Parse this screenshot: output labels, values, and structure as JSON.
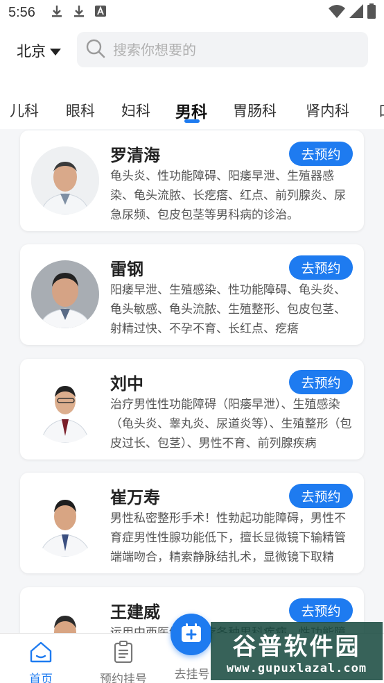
{
  "status_bar": {
    "time": "5:56"
  },
  "header": {
    "city": "北京",
    "search_placeholder": "搜索你想要的"
  },
  "tabs": [
    {
      "label": "儿科",
      "active": false
    },
    {
      "label": "眼科",
      "active": false
    },
    {
      "label": "妇科",
      "active": false
    },
    {
      "label": "男科",
      "active": true
    },
    {
      "label": "胃肠科",
      "active": false
    },
    {
      "label": "肾内科",
      "active": false
    },
    {
      "label": "口",
      "active": false
    }
  ],
  "doctors": [
    {
      "name": "罗清海",
      "book_label": "去预约",
      "description": "龟头炎、性功能障碍、阳痿早泄、生殖器感染、龟头流脓、长疙瘩、红点、前列腺炎、尿急尿频、包皮包茎等男科病的诊治。"
    },
    {
      "name": "雷钢",
      "book_label": "去预约",
      "description": "阳痿早泄、生殖感染、性功能障碍、龟头炎、龟头敏感、龟头流脓、生殖整形、包皮包茎、射精过快、不孕不育、长红点、疙瘩"
    },
    {
      "name": "刘中",
      "book_label": "去预约",
      "description": "治疗男性性功能障碍（阳痿早泄）、生殖感染（龟头炎、睾丸炎、尿道炎等）、生殖整形（包皮过长、包茎）、男性不育、前列腺疾病"
    },
    {
      "name": "崔万寿",
      "book_label": "去预约",
      "description": "男性私密整形手术！性勃起功能障碍，男性不育症男性性腺功能低下，擅长显微镜下输精管端端吻合，精索静脉结扎术，显微镜下取精"
    },
    {
      "name": "王建威",
      "book_label": "去预约",
      "description": "运用中西医结合治疗各种男科疾病，性功能障碍"
    }
  ],
  "bottom_nav": [
    {
      "label": "首页",
      "icon": "home-icon",
      "active": true
    },
    {
      "label": "预约挂号",
      "icon": "clipboard-icon",
      "active": false
    },
    {
      "label": "去挂号",
      "icon": "calendar-plus-icon",
      "active": false
    }
  ],
  "watermark": {
    "title": "谷普软件园",
    "url": "www.gupuxlazal.com"
  },
  "colors": {
    "accent": "#1e7bf0",
    "background": "#f5f6f8",
    "card": "#ffffff"
  }
}
